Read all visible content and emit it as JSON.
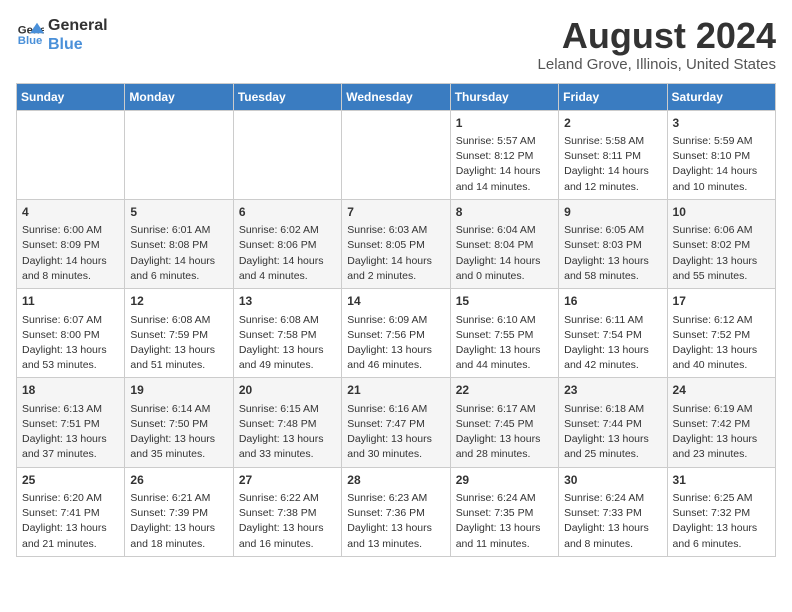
{
  "logo": {
    "line1": "General",
    "line2": "Blue"
  },
  "title": "August 2024",
  "subtitle": "Leland Grove, Illinois, United States",
  "weekdays": [
    "Sunday",
    "Monday",
    "Tuesday",
    "Wednesday",
    "Thursday",
    "Friday",
    "Saturday"
  ],
  "weeks": [
    [
      {
        "day": "",
        "info": ""
      },
      {
        "day": "",
        "info": ""
      },
      {
        "day": "",
        "info": ""
      },
      {
        "day": "",
        "info": ""
      },
      {
        "day": "1",
        "info": "Sunrise: 5:57 AM\nSunset: 8:12 PM\nDaylight: 14 hours\nand 14 minutes."
      },
      {
        "day": "2",
        "info": "Sunrise: 5:58 AM\nSunset: 8:11 PM\nDaylight: 14 hours\nand 12 minutes."
      },
      {
        "day": "3",
        "info": "Sunrise: 5:59 AM\nSunset: 8:10 PM\nDaylight: 14 hours\nand 10 minutes."
      }
    ],
    [
      {
        "day": "4",
        "info": "Sunrise: 6:00 AM\nSunset: 8:09 PM\nDaylight: 14 hours\nand 8 minutes."
      },
      {
        "day": "5",
        "info": "Sunrise: 6:01 AM\nSunset: 8:08 PM\nDaylight: 14 hours\nand 6 minutes."
      },
      {
        "day": "6",
        "info": "Sunrise: 6:02 AM\nSunset: 8:06 PM\nDaylight: 14 hours\nand 4 minutes."
      },
      {
        "day": "7",
        "info": "Sunrise: 6:03 AM\nSunset: 8:05 PM\nDaylight: 14 hours\nand 2 minutes."
      },
      {
        "day": "8",
        "info": "Sunrise: 6:04 AM\nSunset: 8:04 PM\nDaylight: 14 hours\nand 0 minutes."
      },
      {
        "day": "9",
        "info": "Sunrise: 6:05 AM\nSunset: 8:03 PM\nDaylight: 13 hours\nand 58 minutes."
      },
      {
        "day": "10",
        "info": "Sunrise: 6:06 AM\nSunset: 8:02 PM\nDaylight: 13 hours\nand 55 minutes."
      }
    ],
    [
      {
        "day": "11",
        "info": "Sunrise: 6:07 AM\nSunset: 8:00 PM\nDaylight: 13 hours\nand 53 minutes."
      },
      {
        "day": "12",
        "info": "Sunrise: 6:08 AM\nSunset: 7:59 PM\nDaylight: 13 hours\nand 51 minutes."
      },
      {
        "day": "13",
        "info": "Sunrise: 6:08 AM\nSunset: 7:58 PM\nDaylight: 13 hours\nand 49 minutes."
      },
      {
        "day": "14",
        "info": "Sunrise: 6:09 AM\nSunset: 7:56 PM\nDaylight: 13 hours\nand 46 minutes."
      },
      {
        "day": "15",
        "info": "Sunrise: 6:10 AM\nSunset: 7:55 PM\nDaylight: 13 hours\nand 44 minutes."
      },
      {
        "day": "16",
        "info": "Sunrise: 6:11 AM\nSunset: 7:54 PM\nDaylight: 13 hours\nand 42 minutes."
      },
      {
        "day": "17",
        "info": "Sunrise: 6:12 AM\nSunset: 7:52 PM\nDaylight: 13 hours\nand 40 minutes."
      }
    ],
    [
      {
        "day": "18",
        "info": "Sunrise: 6:13 AM\nSunset: 7:51 PM\nDaylight: 13 hours\nand 37 minutes."
      },
      {
        "day": "19",
        "info": "Sunrise: 6:14 AM\nSunset: 7:50 PM\nDaylight: 13 hours\nand 35 minutes."
      },
      {
        "day": "20",
        "info": "Sunrise: 6:15 AM\nSunset: 7:48 PM\nDaylight: 13 hours\nand 33 minutes."
      },
      {
        "day": "21",
        "info": "Sunrise: 6:16 AM\nSunset: 7:47 PM\nDaylight: 13 hours\nand 30 minutes."
      },
      {
        "day": "22",
        "info": "Sunrise: 6:17 AM\nSunset: 7:45 PM\nDaylight: 13 hours\nand 28 minutes."
      },
      {
        "day": "23",
        "info": "Sunrise: 6:18 AM\nSunset: 7:44 PM\nDaylight: 13 hours\nand 25 minutes."
      },
      {
        "day": "24",
        "info": "Sunrise: 6:19 AM\nSunset: 7:42 PM\nDaylight: 13 hours\nand 23 minutes."
      }
    ],
    [
      {
        "day": "25",
        "info": "Sunrise: 6:20 AM\nSunset: 7:41 PM\nDaylight: 13 hours\nand 21 minutes."
      },
      {
        "day": "26",
        "info": "Sunrise: 6:21 AM\nSunset: 7:39 PM\nDaylight: 13 hours\nand 18 minutes."
      },
      {
        "day": "27",
        "info": "Sunrise: 6:22 AM\nSunset: 7:38 PM\nDaylight: 13 hours\nand 16 minutes."
      },
      {
        "day": "28",
        "info": "Sunrise: 6:23 AM\nSunset: 7:36 PM\nDaylight: 13 hours\nand 13 minutes."
      },
      {
        "day": "29",
        "info": "Sunrise: 6:24 AM\nSunset: 7:35 PM\nDaylight: 13 hours\nand 11 minutes."
      },
      {
        "day": "30",
        "info": "Sunrise: 6:24 AM\nSunset: 7:33 PM\nDaylight: 13 hours\nand 8 minutes."
      },
      {
        "day": "31",
        "info": "Sunrise: 6:25 AM\nSunset: 7:32 PM\nDaylight: 13 hours\nand 6 minutes."
      }
    ]
  ]
}
